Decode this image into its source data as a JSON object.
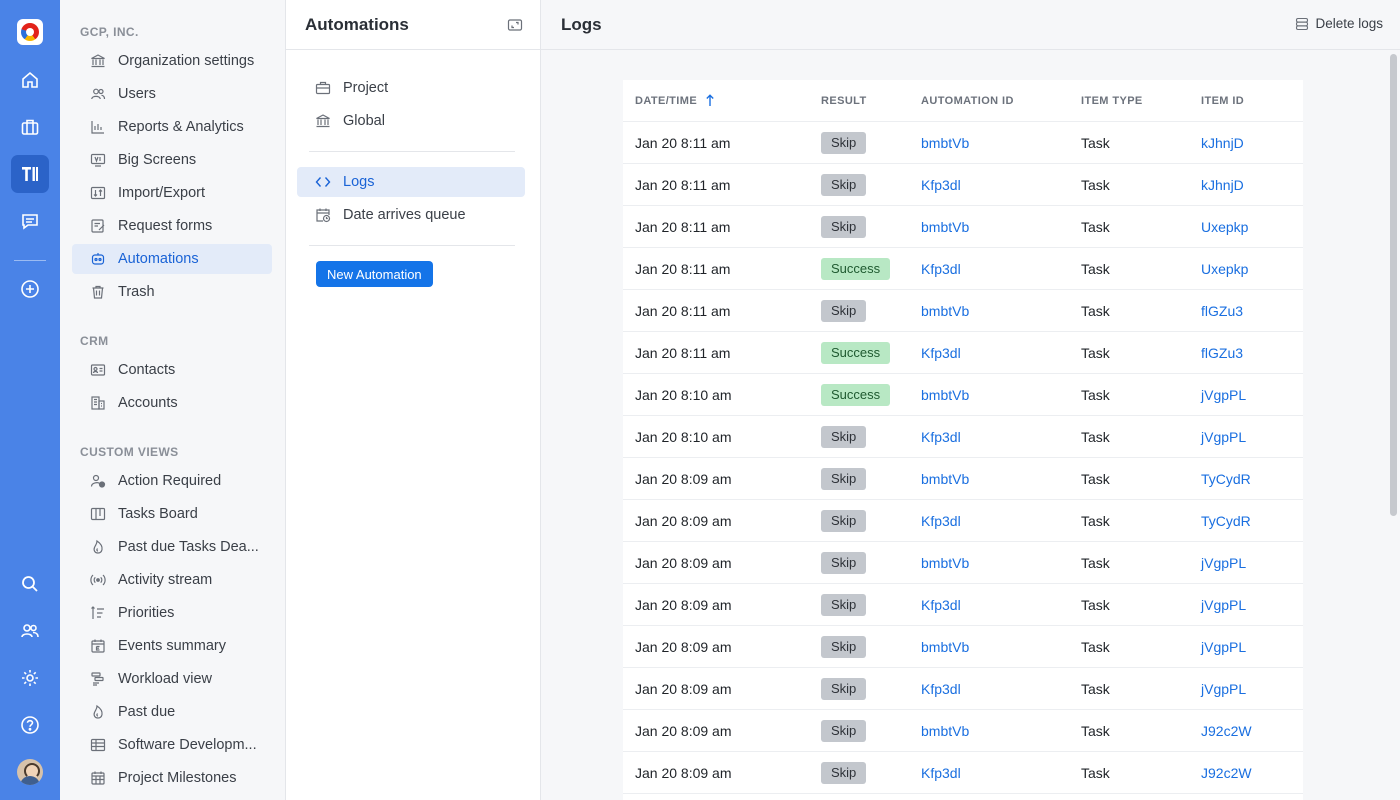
{
  "rail": {
    "items": [
      {
        "name": "home-icon"
      },
      {
        "name": "briefcase-icon"
      },
      {
        "name": "workspace-icon"
      },
      {
        "name": "chat-icon"
      },
      {
        "name": "add-icon"
      },
      {
        "name": "search-icon"
      },
      {
        "name": "people-icon"
      },
      {
        "name": "gear-icon"
      },
      {
        "name": "help-icon"
      }
    ]
  },
  "nav": {
    "org_section": "GCP, INC.",
    "org_items": [
      {
        "label": "Organization settings",
        "icon": "bank-icon"
      },
      {
        "label": "Users",
        "icon": "users-icon"
      },
      {
        "label": "Reports & Analytics",
        "icon": "bar-chart-icon"
      },
      {
        "label": "Big Screens",
        "icon": "tv-icon"
      },
      {
        "label": "Import/Export",
        "icon": "import-export-icon"
      },
      {
        "label": "Request forms",
        "icon": "form-icon"
      },
      {
        "label": "Automations",
        "icon": "robot-icon"
      },
      {
        "label": "Trash",
        "icon": "trash-icon"
      }
    ],
    "crm_section": "CRM",
    "crm_items": [
      {
        "label": "Contacts",
        "icon": "contact-card-icon"
      },
      {
        "label": "Accounts",
        "icon": "building-icon"
      }
    ],
    "views_section": "CUSTOM VIEWS",
    "view_items": [
      {
        "label": "Action Required",
        "icon": "user-alert-icon"
      },
      {
        "label": "Tasks Board",
        "icon": "board-icon"
      },
      {
        "label": "Past due Tasks Dea...",
        "icon": "flame-icon"
      },
      {
        "label": "Activity stream",
        "icon": "broadcast-icon"
      },
      {
        "label": "Priorities",
        "icon": "priority-icon"
      },
      {
        "label": "Events summary",
        "icon": "calendar-icon"
      },
      {
        "label": "Workload view",
        "icon": "workload-icon"
      },
      {
        "label": "Past due",
        "icon": "flame-icon"
      },
      {
        "label": "Software Developm...",
        "icon": "table-icon"
      },
      {
        "label": "Project Milestones",
        "icon": "calendar-grid-icon"
      }
    ]
  },
  "mid": {
    "title": "Automations",
    "scope_items": [
      {
        "label": "Project",
        "icon": "briefcase-icon"
      },
      {
        "label": "Global",
        "icon": "bank-icon"
      }
    ],
    "tool_items": [
      {
        "label": "Logs",
        "icon": "code-icon"
      },
      {
        "label": "Date arrives queue",
        "icon": "calendar-clock-icon"
      }
    ],
    "new_button": "New Automation"
  },
  "main": {
    "title": "Logs",
    "delete_button": "Delete logs",
    "columns": [
      "DATE/TIME",
      "RESULT",
      "AUTOMATION ID",
      "ITEM TYPE",
      "ITEM ID"
    ],
    "rows": [
      {
        "datetime": "Jan 20 8:11 am",
        "result": "Skip",
        "automation_id": "bmbtVb",
        "item_type": "Task",
        "item_id": "kJhnjD"
      },
      {
        "datetime": "Jan 20 8:11 am",
        "result": "Skip",
        "automation_id": "Kfp3dl",
        "item_type": "Task",
        "item_id": "kJhnjD"
      },
      {
        "datetime": "Jan 20 8:11 am",
        "result": "Skip",
        "automation_id": "bmbtVb",
        "item_type": "Task",
        "item_id": "Uxepkp"
      },
      {
        "datetime": "Jan 20 8:11 am",
        "result": "Success",
        "automation_id": "Kfp3dl",
        "item_type": "Task",
        "item_id": "Uxepkp"
      },
      {
        "datetime": "Jan 20 8:11 am",
        "result": "Skip",
        "automation_id": "bmbtVb",
        "item_type": "Task",
        "item_id": "flGZu3"
      },
      {
        "datetime": "Jan 20 8:11 am",
        "result": "Success",
        "automation_id": "Kfp3dl",
        "item_type": "Task",
        "item_id": "flGZu3"
      },
      {
        "datetime": "Jan 20 8:10 am",
        "result": "Success",
        "automation_id": "bmbtVb",
        "item_type": "Task",
        "item_id": "jVgpPL"
      },
      {
        "datetime": "Jan 20 8:10 am",
        "result": "Skip",
        "automation_id": "Kfp3dl",
        "item_type": "Task",
        "item_id": "jVgpPL"
      },
      {
        "datetime": "Jan 20 8:09 am",
        "result": "Skip",
        "automation_id": "bmbtVb",
        "item_type": "Task",
        "item_id": "TyCydR"
      },
      {
        "datetime": "Jan 20 8:09 am",
        "result": "Skip",
        "automation_id": "Kfp3dl",
        "item_type": "Task",
        "item_id": "TyCydR"
      },
      {
        "datetime": "Jan 20 8:09 am",
        "result": "Skip",
        "automation_id": "bmbtVb",
        "item_type": "Task",
        "item_id": "jVgpPL"
      },
      {
        "datetime": "Jan 20 8:09 am",
        "result": "Skip",
        "automation_id": "Kfp3dl",
        "item_type": "Task",
        "item_id": "jVgpPL"
      },
      {
        "datetime": "Jan 20 8:09 am",
        "result": "Skip",
        "automation_id": "bmbtVb",
        "item_type": "Task",
        "item_id": "jVgpPL"
      },
      {
        "datetime": "Jan 20 8:09 am",
        "result": "Skip",
        "automation_id": "Kfp3dl",
        "item_type": "Task",
        "item_id": "jVgpPL"
      },
      {
        "datetime": "Jan 20 8:09 am",
        "result": "Skip",
        "automation_id": "bmbtVb",
        "item_type": "Task",
        "item_id": "J92c2W"
      },
      {
        "datetime": "Jan 20 8:09 am",
        "result": "Skip",
        "automation_id": "Kfp3dl",
        "item_type": "Task",
        "item_id": "J92c2W"
      }
    ]
  },
  "colors": {
    "rail": "#4a83e7",
    "accent": "#1474e8",
    "link": "#1a6fe0",
    "skip_badge": "#c3c7cd",
    "success_badge": "#b8e8c4"
  }
}
